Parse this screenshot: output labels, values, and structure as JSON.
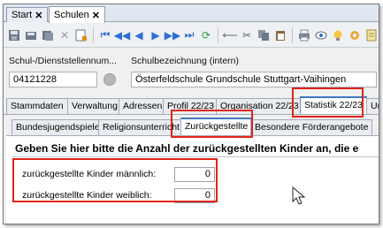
{
  "doc_tabs": [
    {
      "label": "Start",
      "close": "✕"
    },
    {
      "label": "Schulen",
      "close": "✕"
    }
  ],
  "toolbar_icons": [
    "save-icon",
    "save-close-icon",
    "save-stack-icon",
    "delete-icon",
    "edit-icon",
    "first-icon",
    "prev-fast-icon",
    "prev-icon",
    "next-icon",
    "next-fast-icon",
    "last-icon",
    "refresh-icon",
    "back-arrow-icon",
    "cut-icon",
    "copy-icon",
    "paste-icon",
    "print-icon",
    "preview-icon",
    "lightbulb-icon",
    "settings-icon",
    "notes-icon"
  ],
  "form": {
    "school_number_label": "Schul-/Dienststellennum...",
    "school_number_value": "04121228",
    "school_name_label": "Schulbezeichnung (intern)",
    "school_name_value": "Österfeldschule Grundschule Stuttgart-Vaihingen"
  },
  "main_tabs": [
    "Stammdaten",
    "Verwaltung",
    "Adressen",
    "Profil 22/23",
    "Organisation 22/23",
    "Statistik 22/23",
    "Un"
  ],
  "sub_tabs": [
    "Bundesjugendspiele",
    "Religionsunterricht",
    "Zurückgestellte",
    "Besondere Förderangebote"
  ],
  "content": {
    "instruction": "Geben Sie hier bitte die Anzahl der zurückgestellten Kinder an, die e",
    "male_label": "zurückgestellte Kinder männlich:",
    "male_value": "0",
    "female_label": "zurückgestellte Kinder weiblich:",
    "female_value": "0"
  },
  "colors": {
    "highlight": "#e0241b",
    "accent": "#3b78c4"
  }
}
